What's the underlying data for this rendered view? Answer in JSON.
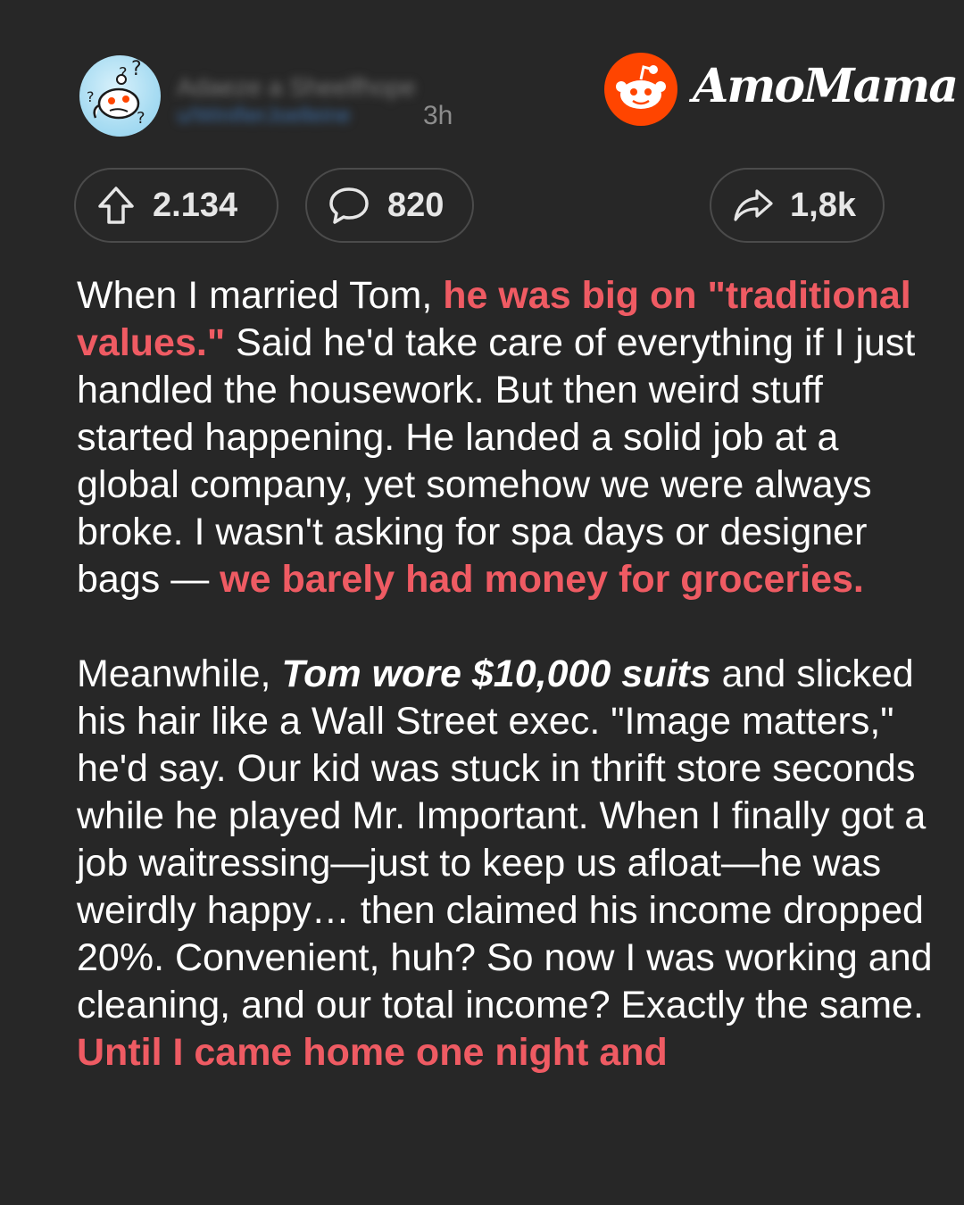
{
  "header": {
    "username": "Adaeze a Sheelfhope",
    "handle": "u/WinifierJoelleine",
    "timestamp": "3h",
    "brand": "AmoMama"
  },
  "actions": {
    "upvotes": "2.134",
    "comments": "820",
    "shares": "1,8k"
  },
  "story": {
    "p1_a": "When I married Tom, ",
    "p1_hl1": "he was big on \"traditional values.\"",
    "p1_b": " Said he'd take care of everything if I just handled the housework. But then weird stuff started happening. He landed a solid job at a global company, yet somehow we were always broke. I wasn't asking for spa days or designer bags — ",
    "p1_hl2": "we barely had money for groceries.",
    "p2_a": "Meanwhile, ",
    "p2_em": "Tom wore $10,000 suits",
    "p2_b": " and slicked his hair like a Wall Street exec. \"Image matters,\" he'd say. Our kid was stuck in thrift store seconds while he played Mr. Important. When I finally got a job waitressing—just to keep us afloat—he was weirdly happy… then claimed his income dropped 20%. Convenient, huh? So now I was working and cleaning, and our total income? Exactly the same.",
    "p2_hl": "Until I came home one night and"
  },
  "icons": {
    "avatar": "confused-snoo-avatar",
    "reddit": "reddit-logo-icon",
    "upvote": "upvote-arrow-icon",
    "comment": "comment-bubble-icon",
    "share": "share-arrow-icon"
  },
  "colors": {
    "background": "#272727",
    "highlight": "#ef5b63",
    "reddit_orange": "#ff4500",
    "pill_border": "#4b4b4b"
  }
}
